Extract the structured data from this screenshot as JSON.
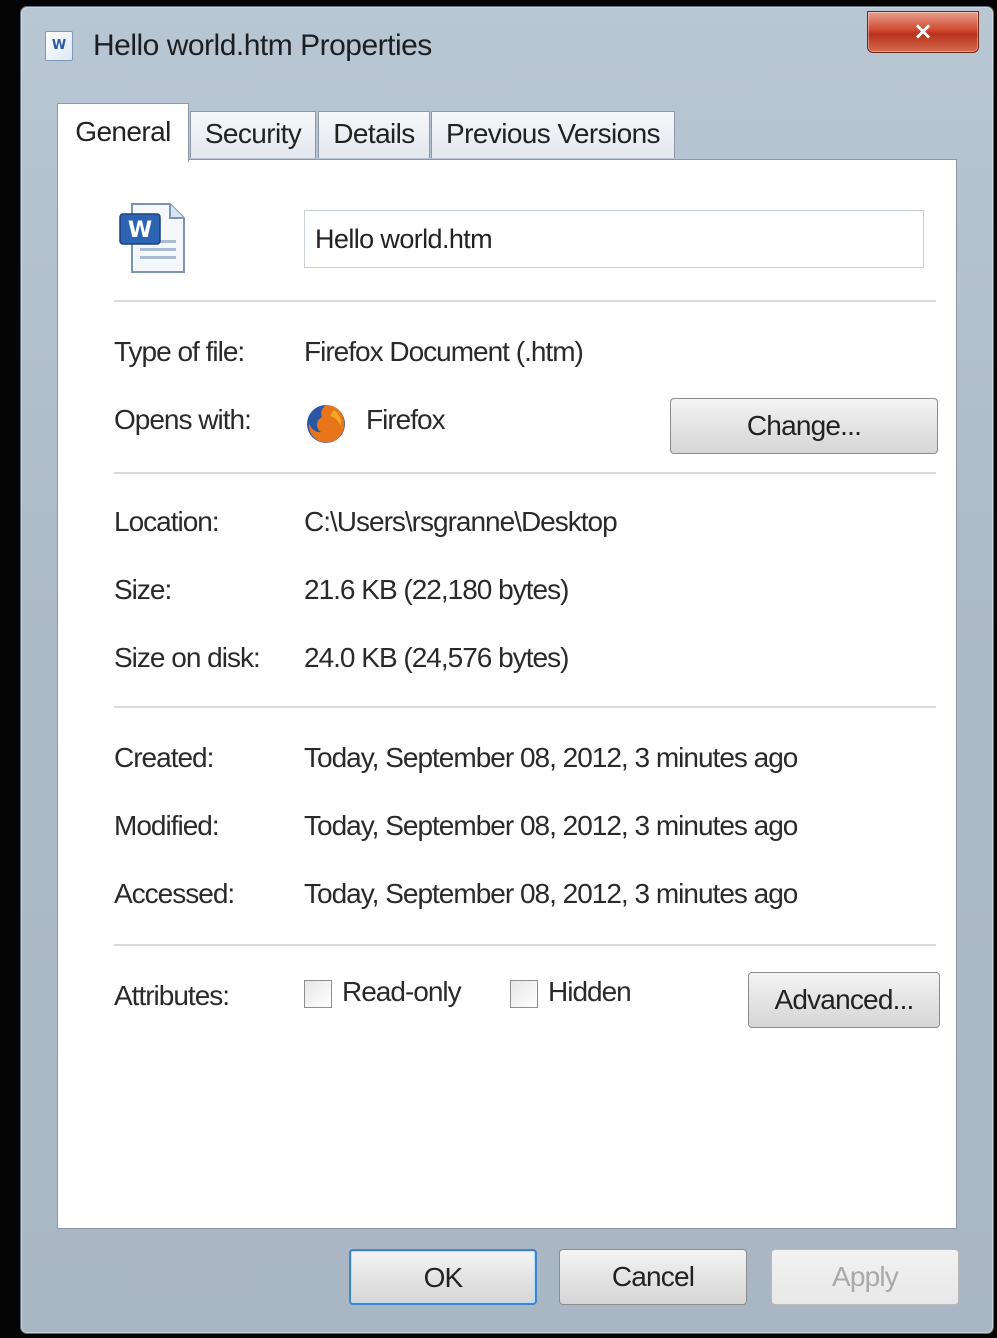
{
  "window": {
    "title": "Hello world.htm Properties",
    "close_glyph": "×"
  },
  "tabs": [
    {
      "label": "General",
      "active": true
    },
    {
      "label": "Security",
      "active": false
    },
    {
      "label": "Details",
      "active": false
    },
    {
      "label": "Previous Versions",
      "active": false
    }
  ],
  "general": {
    "file_icon": "word-document-icon",
    "file_name": "Hello world.htm",
    "type_of_file_label": "Type of file:",
    "type_of_file_value": "Firefox Document (.htm)",
    "opens_with_label": "Opens with:",
    "opens_with_app_icon": "firefox-icon",
    "opens_with_value": "Firefox",
    "change_button": "Change...",
    "location_label": "Location:",
    "location_value": "C:\\Users\\rsgranne\\Desktop",
    "size_label": "Size:",
    "size_value": "21.6 KB (22,180 bytes)",
    "size_on_disk_label": "Size on disk:",
    "size_on_disk_value": "24.0 KB (24,576 bytes)",
    "created_label": "Created:",
    "created_value": "Today, September 08, 2012, 3 minutes ago",
    "modified_label": "Modified:",
    "modified_value": "Today, September 08, 2012, 3 minutes ago",
    "accessed_label": "Accessed:",
    "accessed_value": "Today, September 08, 2012, 3 minutes ago",
    "attributes_label": "Attributes:",
    "readonly_label": "Read-only",
    "readonly_checked": false,
    "hidden_label": "Hidden",
    "hidden_checked": false,
    "advanced_button": "Advanced..."
  },
  "footer": {
    "ok_button": "OK",
    "cancel_button": "Cancel",
    "apply_button": "Apply",
    "apply_enabled": false
  }
}
